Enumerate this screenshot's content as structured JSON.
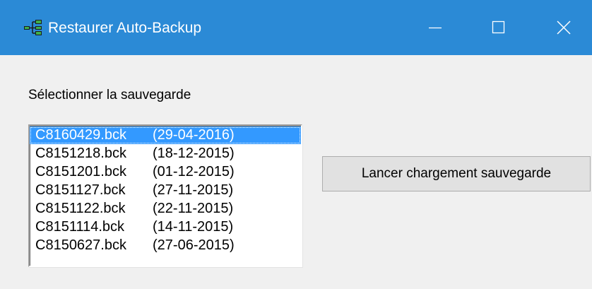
{
  "window": {
    "title": "Restaurer Auto-Backup",
    "app_icon": "network-tree-icon",
    "title_bar_color": "#2b8ad6",
    "controls": [
      "minimize-icon",
      "maximize-icon",
      "close-icon"
    ]
  },
  "content": {
    "select_label": "Sélectionner la sauvegarde",
    "backups": [
      {
        "file": "C8160429.bck",
        "date": "(29-04-2016)",
        "selected": true
      },
      {
        "file": "C8151218.bck",
        "date": "(18-12-2015)",
        "selected": false
      },
      {
        "file": "C8151201.bck",
        "date": "(01-12-2015)",
        "selected": false
      },
      {
        "file": "C8151127.bck",
        "date": "(27-11-2015)",
        "selected": false
      },
      {
        "file": "C8151122.bck",
        "date": "(22-11-2015)",
        "selected": false
      },
      {
        "file": "C8151114.bck",
        "date": "(14-11-2015)",
        "selected": false
      },
      {
        "file": "C8150627.bck",
        "date": "(27-06-2015)",
        "selected": false
      }
    ],
    "selection_color": "#3399ff",
    "load_button_label": "Lancer chargement sauvegarde"
  }
}
